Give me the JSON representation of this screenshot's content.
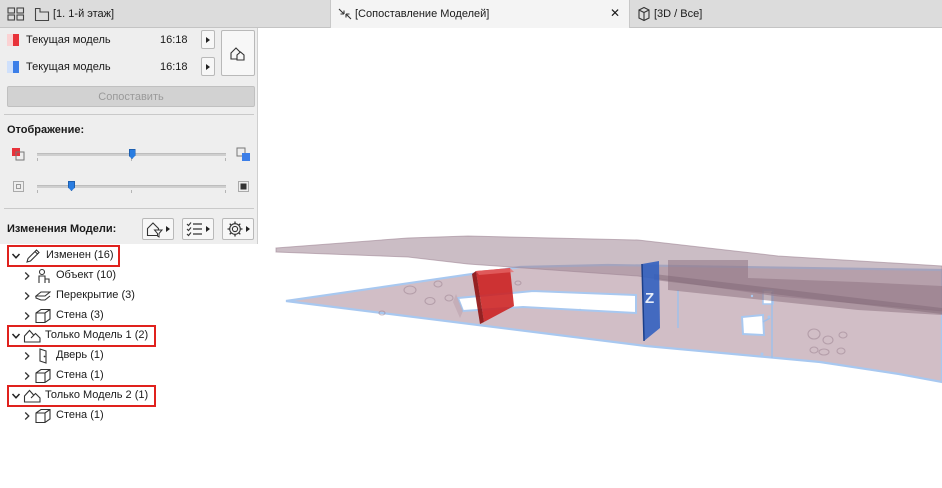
{
  "tabs": [
    {
      "label": "[1. 1-й этаж]",
      "icon": "floor-plan-icon"
    },
    {
      "label": "[Сопоставление Моделей]",
      "icon": "compare-arrows-icon",
      "active": true
    },
    {
      "label": "[3D / Все]",
      "icon": "cube-3d-icon"
    }
  ],
  "models": [
    {
      "name": "Текущая модель",
      "time": "16:18",
      "color": "#e8323a"
    },
    {
      "name": "Текущая модель",
      "time": "16:18",
      "color": "#3b7ee8"
    }
  ],
  "compare_button": "Сопоставить",
  "display": {
    "title": "Отображение:",
    "sliders": [
      {
        "name": "color-blend",
        "value": 0.5
      },
      {
        "name": "transparency",
        "value": 0.18
      }
    ]
  },
  "changes": {
    "title": "Изменения Модели:",
    "tools": [
      "filter-icon",
      "list-icon",
      "settings-icon"
    ]
  },
  "tree": {
    "groups": [
      {
        "label": "Изменен (16)",
        "icon": "pencil-icon",
        "highlighted": true,
        "children": [
          {
            "label": "Объект (10)",
            "icon": "object-icon"
          },
          {
            "label": "Перекрытие (3)",
            "icon": "slab-icon"
          },
          {
            "label": "Стена (3)",
            "icon": "wall-icon"
          }
        ]
      },
      {
        "label": "Только Модель 1 (2)",
        "icon": "model-1-icon",
        "highlighted": true,
        "children": [
          {
            "label": "Дверь (1)",
            "icon": "door-icon"
          },
          {
            "label": "Стена (1)",
            "icon": "wall-icon"
          }
        ]
      },
      {
        "label": "Только Модель 2 (1)",
        "icon": "model-2-icon",
        "highlighted": true,
        "children": [
          {
            "label": "Стена (1)",
            "icon": "wall-icon"
          }
        ]
      }
    ]
  },
  "viewport": {
    "highlight_colors": {
      "model1": "#cc1f1f",
      "model2": "#2f5fbf",
      "slab": "#b99da8",
      "edge": "#9fc3ee"
    },
    "axis_letter": "Z"
  }
}
